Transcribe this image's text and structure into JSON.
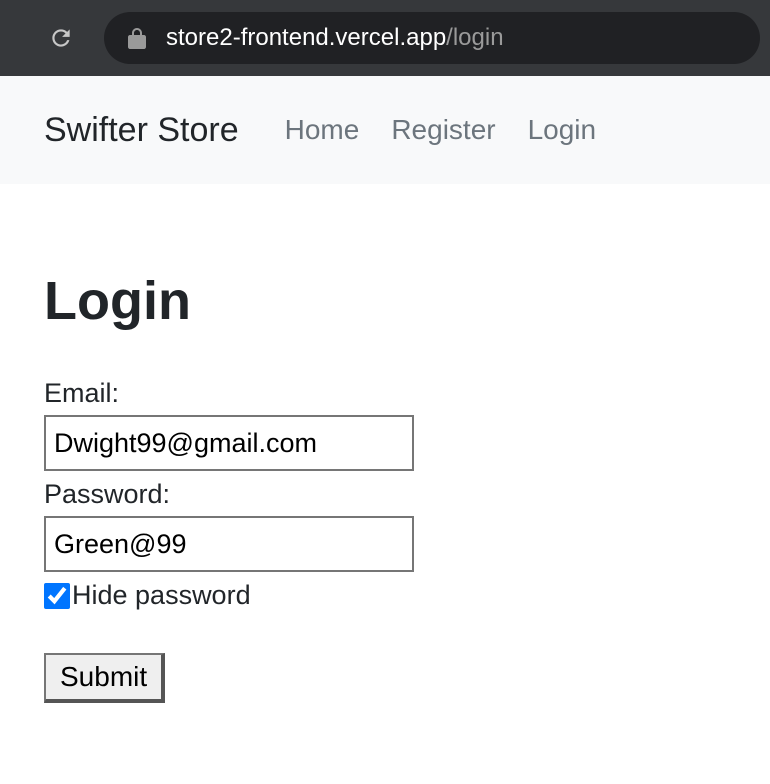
{
  "browser": {
    "url_host": "store2-frontend.vercel.app",
    "url_path": "/login"
  },
  "header": {
    "brand": "Swifter Store",
    "nav": [
      {
        "label": "Home"
      },
      {
        "label": "Register"
      },
      {
        "label": "Login"
      }
    ]
  },
  "page": {
    "title": "Login"
  },
  "form": {
    "email_label": "Email:",
    "email_value": "Dwight99@gmail.com",
    "password_label": "Password:",
    "password_value": "Green@99",
    "hide_password_label": "Hide password",
    "hide_password_checked": true,
    "submit_label": "Submit"
  }
}
